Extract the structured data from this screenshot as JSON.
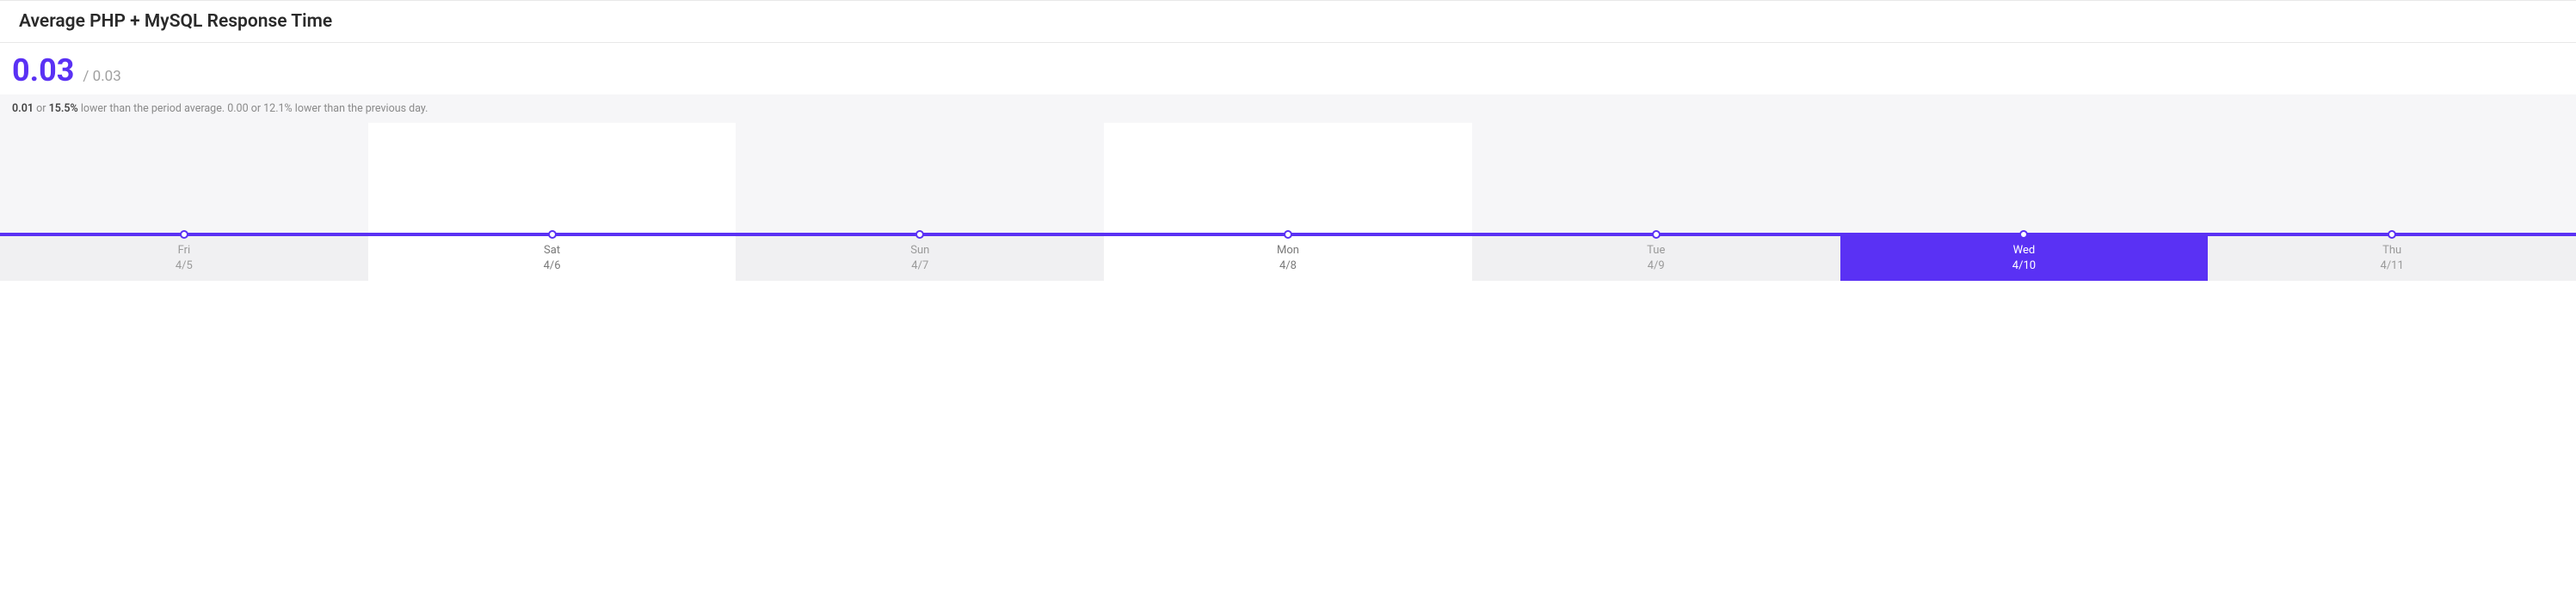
{
  "header": {
    "title": "Average PHP + MySQL Response Time"
  },
  "metrics": {
    "primary": "0.03",
    "secondary": "/ 0.03"
  },
  "summary": {
    "bold1": "0.01",
    "text1": " or ",
    "bold2": "15.5%",
    "text2": " lower than the period average. 0.00 or 12.1% lower than the previous day."
  },
  "chart_data": {
    "type": "line",
    "title": "Average PHP + MySQL Response Time",
    "xlabel": "",
    "ylabel": "",
    "categories": [
      "Fri 4/5",
      "Sat 4/6",
      "Sun 4/7",
      "Mon 4/8",
      "Tue 4/9",
      "Wed 4/10",
      "Thu 4/11"
    ],
    "values": [
      0.03,
      0.03,
      0.03,
      0.03,
      0.03,
      0.03,
      0.03
    ],
    "selected_index": 5,
    "light_indices": [
      1,
      3
    ],
    "ylim": [
      0,
      0.1
    ]
  },
  "axis": {
    "days": [
      {
        "day": "Fri",
        "date": "4/5"
      },
      {
        "day": "Sat",
        "date": "4/6"
      },
      {
        "day": "Sun",
        "date": "4/7"
      },
      {
        "day": "Mon",
        "date": "4/8"
      },
      {
        "day": "Tue",
        "date": "4/9"
      },
      {
        "day": "Wed",
        "date": "4/10"
      },
      {
        "day": "Thu",
        "date": "4/11"
      }
    ]
  }
}
